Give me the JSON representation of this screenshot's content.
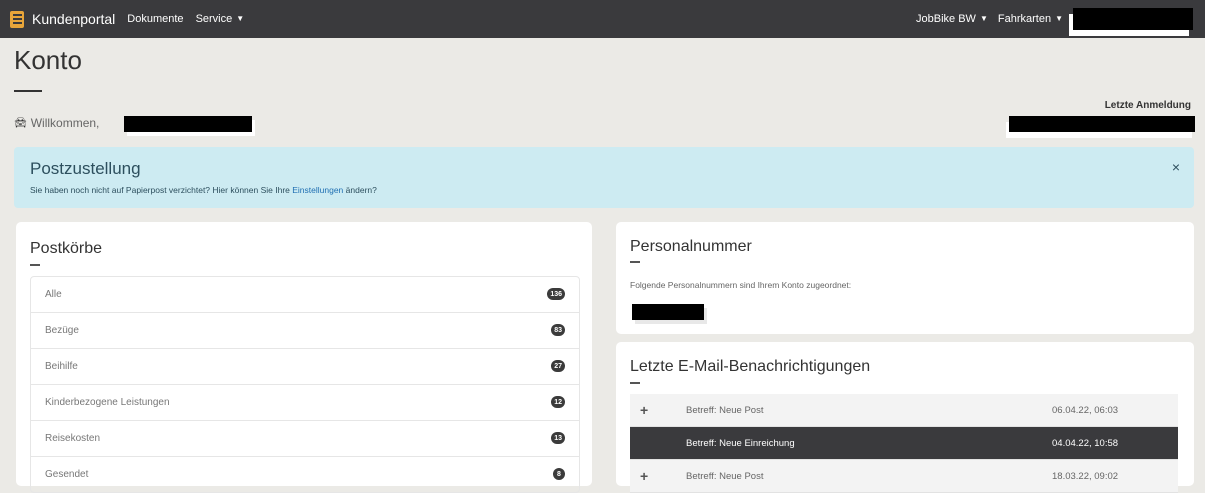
{
  "navbar": {
    "brand": "Kundenportal",
    "links": [
      "Dokumente",
      "Service"
    ],
    "right_links": [
      "JobBike BW",
      "Fahrkarten"
    ]
  },
  "header": {
    "title": "Konto",
    "welcome": "Willkommen,",
    "last_login_label": "Letzte Anmeldung"
  },
  "alert": {
    "title": "Postzustellung",
    "text_before": "Sie haben noch nicht auf Papierpost verzichtet? Hier können Sie Ihre ",
    "link": "Einstellungen",
    "text_after": " ändern?",
    "close": "×"
  },
  "postkoerbe": {
    "title": "Postkörbe",
    "items": [
      {
        "label": "Alle",
        "count": "136"
      },
      {
        "label": "Bezüge",
        "count": "83"
      },
      {
        "label": "Beihilfe",
        "count": "27"
      },
      {
        "label": "Kinderbezogene Leistungen",
        "count": "12"
      },
      {
        "label": "Reisekosten",
        "count": "13"
      },
      {
        "label": "Gesendet",
        "count": "8"
      }
    ]
  },
  "personal": {
    "title": "Personalnummer",
    "text": "Folgende Personalnummern sind Ihrem Konto zugeordnet:"
  },
  "notifications": {
    "title": "Letzte E-Mail-Benachrichtigungen",
    "items": [
      {
        "subject": "Betreff: Neue Post",
        "date": "06.04.22, 06:03",
        "active": false
      },
      {
        "subject": "Betreff: Neue Einreichung",
        "date": "04.04.22, 10:58",
        "active": true
      },
      {
        "subject": "Betreff: Neue Post",
        "date": "18.03.22, 09:02",
        "active": false
      }
    ]
  },
  "colors": {
    "navbar": "#3a3a3d",
    "background": "#ebeae6",
    "alert": "#cdebf2",
    "brand_logo": "#e8a53a",
    "link": "#1f6fb2"
  },
  "icons": {
    "brand": "state-crest-icon",
    "welcome": "car-icon",
    "expand": "plus-icon",
    "dropdown": "caret-down-icon"
  }
}
